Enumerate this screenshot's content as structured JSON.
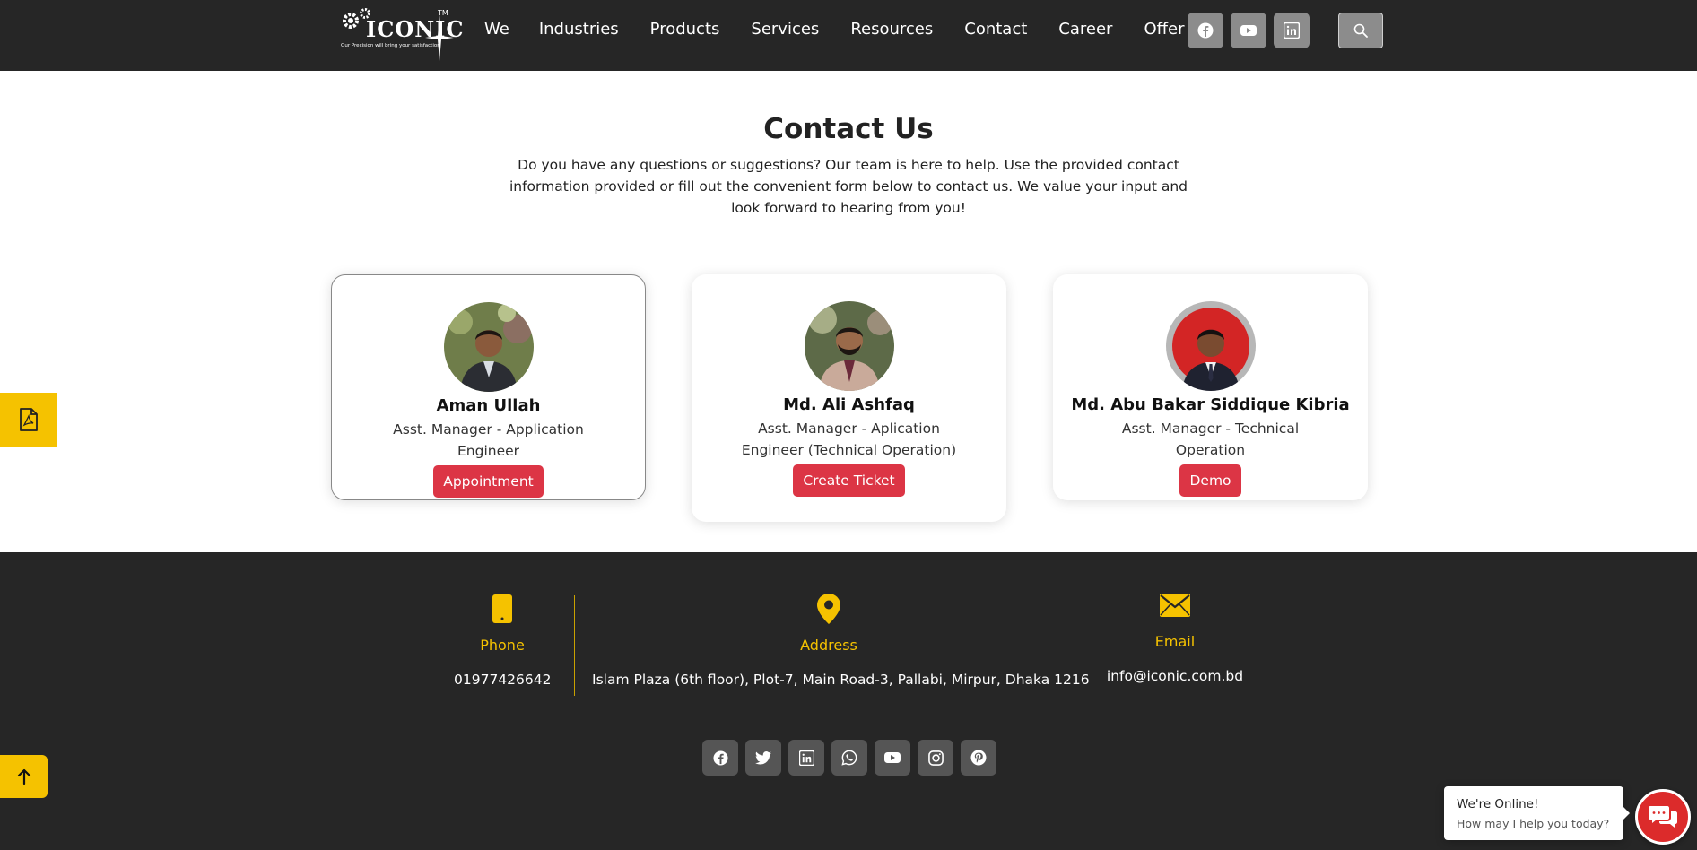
{
  "header": {
    "logo": {
      "text": "ICONIC",
      "trademark": "TM",
      "tagline": "Our Precision will bring your satisfaction"
    },
    "nav": [
      "We",
      "Industries",
      "Products",
      "Services",
      "Resources",
      "Contact",
      "Career",
      "Offer"
    ],
    "social_icons": [
      "facebook-icon",
      "youtube-icon",
      "linkedin-icon"
    ],
    "search_icon": "search-icon"
  },
  "hero": {
    "title": "Contact Us",
    "intro": "Do you have any questions or suggestions? Our team is here to help. Use the provided contact information provided or fill out the convenient form below to contact us. We value your input and look forward to hearing from you!"
  },
  "contacts": [
    {
      "name": "Aman Ullah",
      "role": "Asst. Manager - Application Engineer",
      "button": "Appointment"
    },
    {
      "name": "Md. Ali Ashfaq",
      "role": "Asst. Manager - Aplication Engineer (Technical Operation)",
      "button": "Create Ticket"
    },
    {
      "name": "Md. Abu Bakar Siddique Kibria",
      "role": "Asst. Manager - Technical Operation",
      "button": "Demo"
    }
  ],
  "footer": {
    "phone": {
      "label": "Phone",
      "value": "01977426642",
      "icon": "phone-icon"
    },
    "address": {
      "label": "Address",
      "value": "Islam Plaza (6th floor), Plot-7, Main Road-3, Pallabi, Mirpur, Dhaka 1216",
      "icon": "location-pin-icon"
    },
    "email": {
      "label": "Email",
      "value": "info@iconic.com.bd",
      "icon": "envelope-icon"
    },
    "social_icons": [
      "facebook-icon",
      "twitter-icon",
      "linkedin-icon",
      "whatsapp-icon",
      "youtube-icon",
      "instagram-icon",
      "pinterest-icon"
    ]
  },
  "chat": {
    "status": "We're Online!",
    "prompt": "How may I help you today?"
  },
  "colors": {
    "header_bg": "#262626",
    "accent_yellow": "#f5c200",
    "button_red": "#dc3545"
  }
}
